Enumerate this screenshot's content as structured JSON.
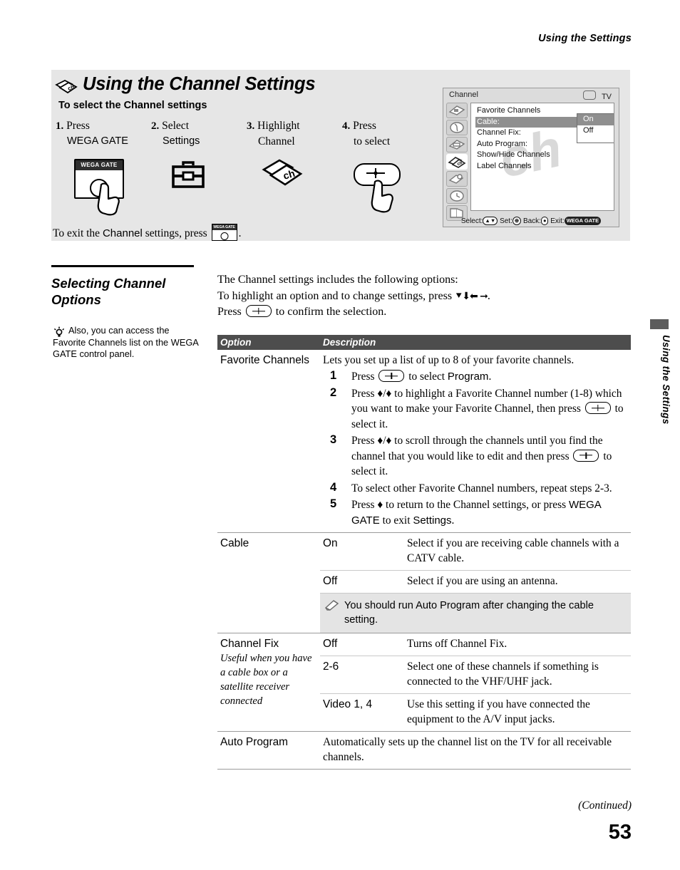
{
  "running_head": "Using the Settings",
  "chapter": {
    "title": "Using the Channel Settings",
    "title_icon": "channel-cards-icon",
    "subhead": "To select the Channel settings"
  },
  "steps": [
    {
      "num": "1.",
      "verb": "Press",
      "target": "WEGA GATE",
      "art": "wega-gate-button-press"
    },
    {
      "num": "2.",
      "verb": "Select",
      "target": "Settings",
      "art": "toolbox-icon"
    },
    {
      "num": "3.",
      "verb": "Highlight",
      "target": "Channel",
      "art": "channel-cards-icon"
    },
    {
      "num": "4.",
      "verb": "Press",
      "target": "to select",
      "art": "select-button-press"
    }
  ],
  "exit_line": {
    "before": "To exit the ",
    "bold": "Channel",
    "middle": " settings, press ",
    "button_label": "WEGA GATE",
    "after": "."
  },
  "osd": {
    "title": "Channel",
    "input_label": "TV",
    "items": [
      "Favorite  Channels",
      "Cable:",
      "Channel  Fix:",
      "Auto  Program:",
      "Show/Hide  Channels",
      "Label  Channels"
    ],
    "highlighted_item": "Cable:",
    "dropdown": {
      "options": [
        "On",
        "Off"
      ],
      "selected": "On"
    },
    "watermark": "ch",
    "footer": {
      "select_label": "Select:",
      "set_label": "Set:",
      "back_label": "Back:",
      "exit_label": "Exit:",
      "exit_key": "WEGA GATE"
    },
    "rail_icons": [
      "picture-settings-icon",
      "audio-settings-icon",
      "screen-settings-icon",
      "channel-settings-icon",
      "parental-settings-icon",
      "timer-settings-icon",
      "setup-settings-icon"
    ]
  },
  "section": {
    "heading": "Selecting Channel Options",
    "tip": "Also, you can access the Favorite Channels list on the WEGA GATE control panel.",
    "tip_icon": "lightbulb-tip-icon"
  },
  "intro": {
    "line1": "The Channel settings includes the following options:",
    "line2_pre": "To highlight an option and to change settings, press ",
    "line2_arrows": "♦♦♦ ♦",
    "line2_post": ".",
    "line3_pre": "Press ",
    "line3_post": " to confirm the selection."
  },
  "table": {
    "headers": {
      "option": "Option",
      "description": "Description"
    },
    "rows": [
      {
        "option": "Favorite Channels",
        "option_note": "",
        "intro": "Lets you set up a list of up to 8 of your favorite channels.",
        "steps": [
          {
            "n": "1",
            "pre": "Press ",
            "mid": " to select ",
            "bold": "Program",
            "post": "."
          },
          {
            "n": "2",
            "text": "Press ♦/♦ to highlight a Favorite Channel number (1-8) which you want to make your Favorite Channel, then press",
            "tail": " to select it."
          },
          {
            "n": "3",
            "text": "Press ♦/♦ to scroll through the channels until you find the channel that you would like to edit and then press",
            "tail": " to select it."
          },
          {
            "n": "4",
            "text": "To select other Favorite Channel numbers, repeat steps 2-3."
          },
          {
            "n": "5",
            "pre": "Press ♦ to return to the Channel settings, or press ",
            "bold": "WEGA GATE",
            "mid": " to exit ",
            "bold2": "Settings",
            "post": "."
          }
        ]
      },
      {
        "option": "Cable",
        "values": [
          {
            "value": "On",
            "desc": "Select if you are receiving cable channels with a CATV cable."
          },
          {
            "value": "Off",
            "desc": "Select if you are using an antenna."
          }
        ],
        "note": "You should run Auto Program after changing the cable setting.",
        "note_icon": "pencil-note-icon"
      },
      {
        "option": "Channel Fix",
        "option_note": "Useful when you have a cable box or a satellite receiver connected",
        "values": [
          {
            "value": "Off",
            "desc": "Turns off Channel Fix."
          },
          {
            "value": "2-6",
            "desc": "Select one of these channels if something is connected to the VHF/UHF jack."
          },
          {
            "value": "Video 1, 4",
            "desc": "Use this setting if you have connected the equipment to the A/V input jacks."
          }
        ]
      },
      {
        "option": "Auto Program",
        "desc": "Automatically sets up the channel list on the TV for all receivable channels."
      }
    ]
  },
  "thumb_tab": "Using the Settings",
  "footer": {
    "continued": "(Continued)",
    "page_number": "53"
  }
}
